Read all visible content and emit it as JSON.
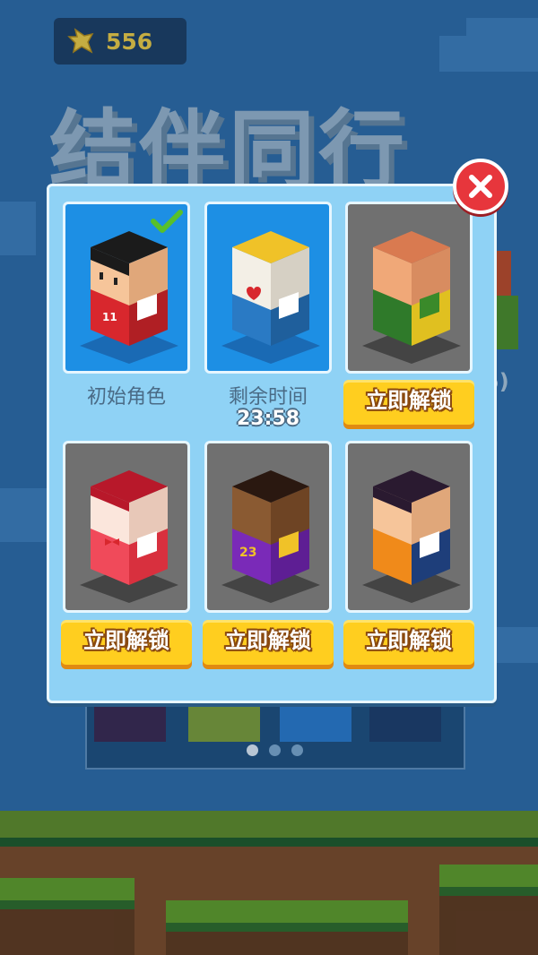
{
  "hud": {
    "coins": "556",
    "coin_icon": "star-icon"
  },
  "background": {
    "title": "结伴同行",
    "peek_text": "5)",
    "pager": {
      "total": 3,
      "active": 0
    }
  },
  "modal": {
    "close_icon": "close-icon",
    "characters": [
      {
        "state": "selected",
        "label": "初始角色",
        "jersey": "11"
      },
      {
        "state": "timed",
        "label": "剩余时间",
        "timer": "23:58"
      },
      {
        "state": "locked",
        "button": "立即解锁"
      },
      {
        "state": "locked",
        "button": "立即解锁"
      },
      {
        "state": "locked",
        "button": "立即解锁",
        "jersey": "23"
      },
      {
        "state": "locked",
        "button": "立即解锁"
      }
    ]
  },
  "colors": {
    "panel": "#8fd2f5",
    "unlocked_card": "#1d8fe4",
    "locked_card": "#707070",
    "button": "#ffce1f",
    "close": "#e7363c"
  }
}
